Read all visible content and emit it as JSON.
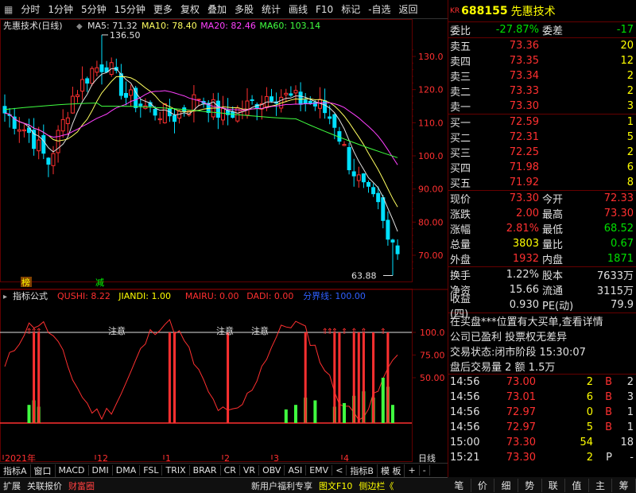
{
  "toolbar": {
    "items": [
      "分时",
      "1分钟",
      "5分钟",
      "15分钟",
      "更多",
      "复权",
      "叠加",
      "多股",
      "统计",
      "画线",
      "F10",
      "标记",
      "-自选",
      "返回"
    ]
  },
  "main_chart": {
    "title": "先惠技术(日线)",
    "ma_labels": [
      {
        "text": "MA5: 71.32",
        "color": "#e0e0e0"
      },
      {
        "text": "MA10: 78.40",
        "color": "#ffff60"
      },
      {
        "text": "MA20: 82.46",
        "color": "#ff40ff"
      },
      {
        "text": "MA60: 103.14",
        "color": "#40ff40"
      }
    ],
    "high_marker": "136.50",
    "low_marker": "63.88",
    "y_labels": [
      "130.0",
      "120.0",
      "110.0",
      "100.0",
      "90.00",
      "80.00",
      "70.00"
    ],
    "tag_bang": "榜",
    "tag_jian": "减"
  },
  "indicator": {
    "title": "指标公式",
    "labels": [
      {
        "text": "QUSHI: 8.22",
        "color": "#ff3030"
      },
      {
        "text": "JIANDI: 1.00",
        "color": "#ffff00"
      },
      {
        "text": "MAIRU: 0.00",
        "color": "#ff3030"
      },
      {
        "text": "DADI: 0.00",
        "color": "#ff3030"
      },
      {
        "text": "分界线: 100.00",
        "color": "#3060ff"
      }
    ],
    "y_labels": [
      "100.0",
      "75.00",
      "50.00"
    ],
    "notes": [
      "注意",
      "注意",
      "注意"
    ]
  },
  "x_axis": {
    "labels": [
      "2021年",
      "12",
      "1",
      "2",
      "3",
      "4"
    ],
    "right_label": "日线"
  },
  "bottom_tabs": [
    "指标A",
    "窗口",
    "MACD",
    "DMI",
    "DMA",
    "FSL",
    "TRIX",
    "BRAR",
    "CR",
    "VR",
    "OBV",
    "ASI",
    "EMV",
    "<",
    "指标B",
    "模 板",
    "+",
    "-"
  ],
  "status_bar": {
    "left": [
      {
        "text": "扩展",
        "color": "#e0e0e0"
      },
      {
        "text": "关联报价",
        "color": "#e0e0e0"
      },
      {
        "text": "财富圈",
        "color": "#ff4040"
      }
    ],
    "middle": [
      {
        "text": "新用户福利专享",
        "color": "#e0e0e0"
      },
      {
        "text": "图文F10",
        "color": "#ffff00"
      },
      {
        "text": "侧边栏《",
        "color": "#ffff00"
      }
    ],
    "right_tabs": [
      "笔",
      "价",
      "细",
      "势",
      "联",
      "值",
      "主",
      "筹"
    ]
  },
  "quote_panel": {
    "kr": "KR",
    "code": "688155",
    "name": "先惠技术",
    "weibi": {
      "label": "委比",
      "value": "-27.87%",
      "label2": "委差",
      "value2": "-17"
    },
    "asks": [
      {
        "label": "卖五",
        "price": "73.36",
        "vol": "20"
      },
      {
        "label": "卖四",
        "price": "73.35",
        "vol": "12"
      },
      {
        "label": "卖三",
        "price": "73.34",
        "vol": "2"
      },
      {
        "label": "卖二",
        "price": "73.33",
        "vol": "2"
      },
      {
        "label": "卖一",
        "price": "73.30",
        "vol": "3"
      }
    ],
    "bids": [
      {
        "label": "买一",
        "price": "72.59",
        "vol": "1"
      },
      {
        "label": "买二",
        "price": "72.31",
        "vol": "5"
      },
      {
        "label": "买三",
        "price": "72.25",
        "vol": "2"
      },
      {
        "label": "买四",
        "price": "71.98",
        "vol": "6"
      },
      {
        "label": "买五",
        "price": "71.92",
        "vol": "8"
      }
    ],
    "stats1": [
      {
        "l1": "现价",
        "v1": "73.30",
        "c1": "red",
        "l2": "今开",
        "v2": "72.33",
        "c2": "red"
      },
      {
        "l1": "涨跌",
        "v1": "2.00",
        "c1": "red",
        "l2": "最高",
        "v2": "73.30",
        "c2": "red"
      },
      {
        "l1": "涨幅",
        "v1": "2.81%",
        "c1": "red",
        "l2": "最低",
        "v2": "68.52",
        "c2": "green"
      },
      {
        "l1": "总量",
        "v1": "3803",
        "c1": "yellow",
        "l2": "量比",
        "v2": "0.67",
        "c2": "green"
      },
      {
        "l1": "外盘",
        "v1": "1932",
        "c1": "red",
        "l2": "内盘",
        "v2": "1871",
        "c2": "green"
      }
    ],
    "stats2": [
      {
        "l1": "换手",
        "v1": "1.22%",
        "c1": "white",
        "l2": "股本",
        "v2": "7633万",
        "c2": "white"
      },
      {
        "l1": "净资",
        "v1": "15.66",
        "c1": "white",
        "l2": "流通",
        "v2": "3115万",
        "c2": "white"
      },
      {
        "l1": "收益(四)",
        "v1": "0.930",
        "c1": "white",
        "l2": "PE(动)",
        "v2": "79.9",
        "c2": "white"
      }
    ],
    "info_lines": [
      "在买盘***位置有大买单,查看详情",
      "公司已盈利 投票权无差异",
      "交易状态:闭市阶段 15:30:07",
      "盘后交易量 2 额 1.5万"
    ],
    "ticks": [
      {
        "t": "14:56",
        "p": "73.00",
        "pc": "red",
        "v": "2",
        "d": "B",
        "dc": "red",
        "n": "2"
      },
      {
        "t": "14:56",
        "p": "73.01",
        "pc": "red",
        "v": "6",
        "d": "B",
        "dc": "red",
        "n": "3"
      },
      {
        "t": "14:56",
        "p": "72.97",
        "pc": "red",
        "v": "0",
        "d": "B",
        "dc": "red",
        "n": "1"
      },
      {
        "t": "14:56",
        "p": "72.97",
        "pc": "red",
        "v": "5",
        "d": "B",
        "dc": "red",
        "n": "1"
      },
      {
        "t": "15:00",
        "p": "73.30",
        "pc": "red",
        "v": "54",
        "d": "",
        "dc": "red",
        "n": "18"
      },
      {
        "t": "15:21",
        "p": "73.30",
        "pc": "red",
        "v": "2",
        "d": "P",
        "dc": "white",
        "n": "-"
      }
    ]
  },
  "colors": {
    "up": "#ff3030",
    "down": "#00e0ff",
    "ma5": "#e0e0e0",
    "ma10": "#ffff60",
    "ma20": "#ff40ff",
    "ma60": "#40ff40",
    "grid": "#600000"
  }
}
